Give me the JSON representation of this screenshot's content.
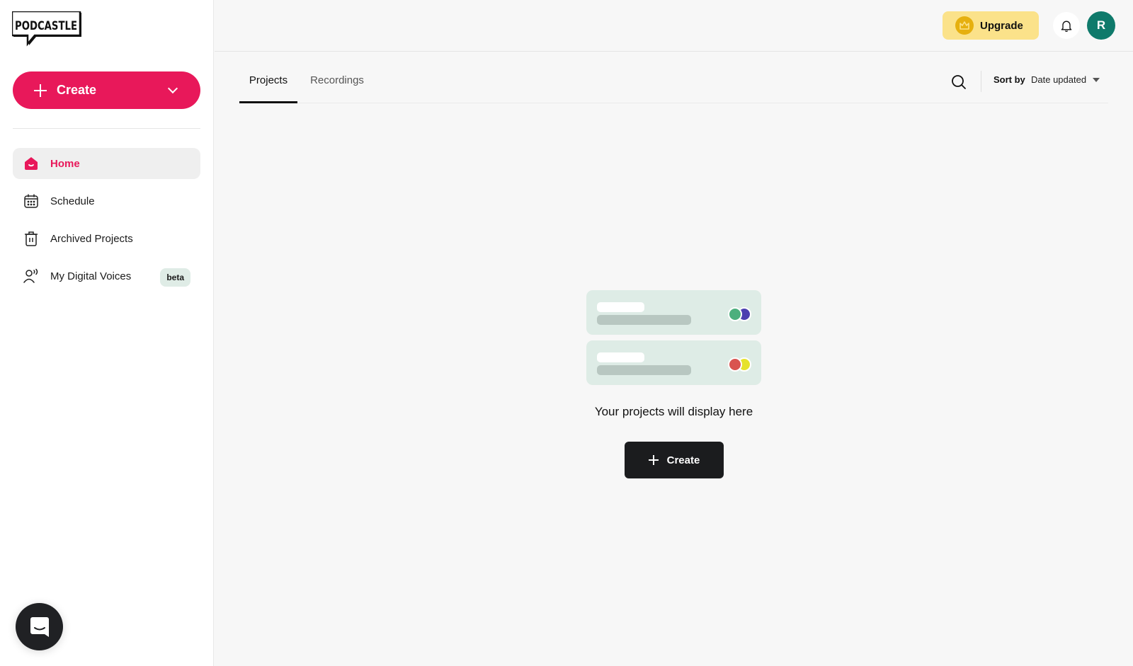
{
  "app": {
    "logo_text": "PODCASTLE"
  },
  "sidebar": {
    "create_button": {
      "label": "Create",
      "icon": "plus-icon",
      "dropdown_icon": "chevron-down-icon"
    },
    "items": [
      {
        "label": "Home",
        "icon": "home-icon",
        "active": true
      },
      {
        "label": "Schedule",
        "icon": "calendar-icon",
        "active": false
      },
      {
        "label": "Archived Projects",
        "icon": "trash-icon",
        "active": false
      },
      {
        "label": "My Digital Voices",
        "icon": "voice-user-icon",
        "active": false,
        "badge": "beta"
      }
    ],
    "chat_widget_icon": "chat-bubble-icon"
  },
  "header": {
    "upgrade_label": "Upgrade",
    "upgrade_icon": "crown-icon",
    "notifications_icon": "bell-icon",
    "avatar_initial": "R"
  },
  "main": {
    "tabs": [
      {
        "label": "Projects",
        "active": true
      },
      {
        "label": "Recordings",
        "active": false
      }
    ],
    "search_icon": "search-icon",
    "sort": {
      "label": "Sort by",
      "value": "Date updated"
    },
    "empty_state": {
      "message": "Your projects will display here",
      "create_label": "Create"
    }
  },
  "colors": {
    "brand": "#e8185a",
    "upgrade_bg": "#fbe28a",
    "avatar_bg": "#0f7a6b",
    "dark_button": "#1b1c1e"
  }
}
